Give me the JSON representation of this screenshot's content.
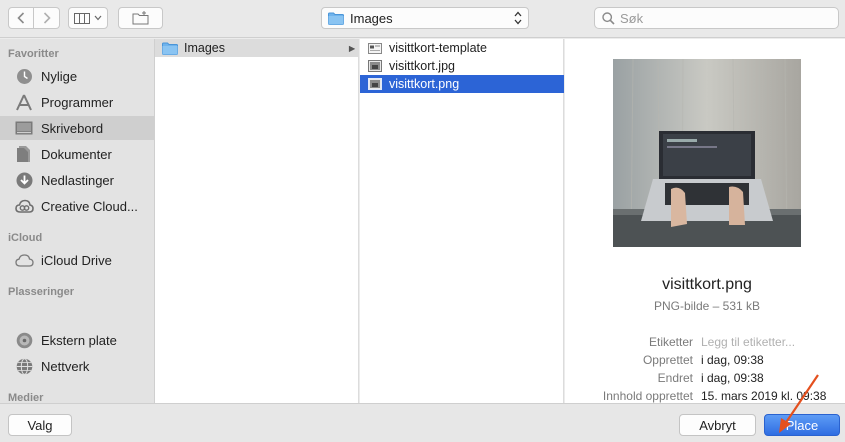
{
  "toolbar": {
    "path_label": "Images",
    "search_placeholder": "Søk"
  },
  "sidebar": {
    "sections": {
      "favorites": "Favoritter",
      "icloud": "iCloud",
      "locations": "Plasseringer",
      "media": "Medier"
    },
    "items": [
      {
        "label": "Nylige",
        "icon": "clock-icon"
      },
      {
        "label": "Programmer",
        "icon": "applications-icon"
      },
      {
        "label": "Skrivebord",
        "icon": "desktop-icon",
        "selected": true
      },
      {
        "label": "Dokumenter",
        "icon": "document-icon"
      },
      {
        "label": "Nedlastinger",
        "icon": "download-icon"
      },
      {
        "label": "Creative Cloud...",
        "icon": "creative-cloud-icon"
      },
      {
        "label": "iCloud Drive",
        "icon": "cloud-icon"
      },
      {
        "label": "Ekstern plate",
        "icon": "external-disk-icon"
      },
      {
        "label": "Nettverk",
        "icon": "network-icon"
      }
    ]
  },
  "column1": {
    "items": [
      {
        "label": "Images",
        "icon": "folder-icon"
      }
    ]
  },
  "column2": {
    "items": [
      {
        "label": "visittkort-template",
        "icon": "template-file-icon"
      },
      {
        "label": "visittkort.jpg",
        "icon": "image-file-icon"
      },
      {
        "label": "visittkort.png",
        "icon": "image-file-icon",
        "selected": true
      }
    ]
  },
  "preview": {
    "filename": "visittkort.png",
    "kind": "PNG-bilde – 531 kB",
    "meta": [
      {
        "key": "Etiketter",
        "value": "Legg til etiketter...",
        "placeholder": true
      },
      {
        "key": "Opprettet",
        "value": "i dag, 09:38"
      },
      {
        "key": "Endret",
        "value": "i dag, 09:38"
      },
      {
        "key": "Innhold opprettet",
        "value": "15. mars 2019 kl. 09:38"
      }
    ]
  },
  "buttons": {
    "options": "Valg",
    "cancel": "Avbryt",
    "place": "Place"
  },
  "colors": {
    "selection": "#2c64d6",
    "annotation_arrow": "#e4501e"
  }
}
